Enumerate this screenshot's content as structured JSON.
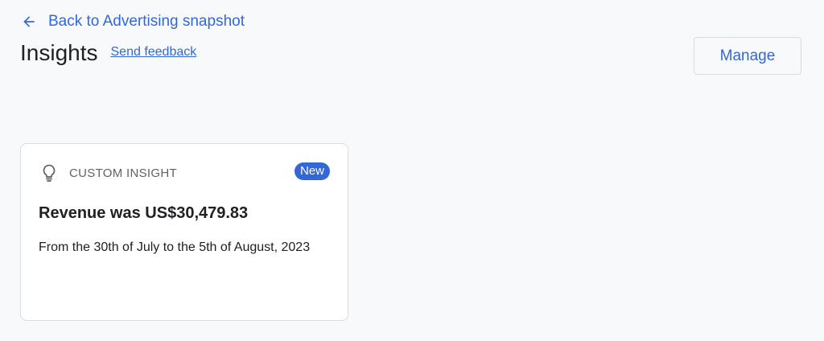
{
  "nav": {
    "back_label": "Back to Advertising snapshot"
  },
  "header": {
    "title": "Insights",
    "feedback_label": "Send feedback",
    "manage_label": "Manage"
  },
  "insight_card": {
    "icon": "lightbulb-icon",
    "label": "CUSTOM INSIGHT",
    "badge": "New",
    "headline": "Revenue was US$30,479.83",
    "body": "From the 30th of July to the 5th of August, 2023"
  },
  "colors": {
    "accent": "#3367d6",
    "background": "#f8f9fa",
    "card_border": "#dadce0",
    "muted_text": "#5f6368"
  }
}
